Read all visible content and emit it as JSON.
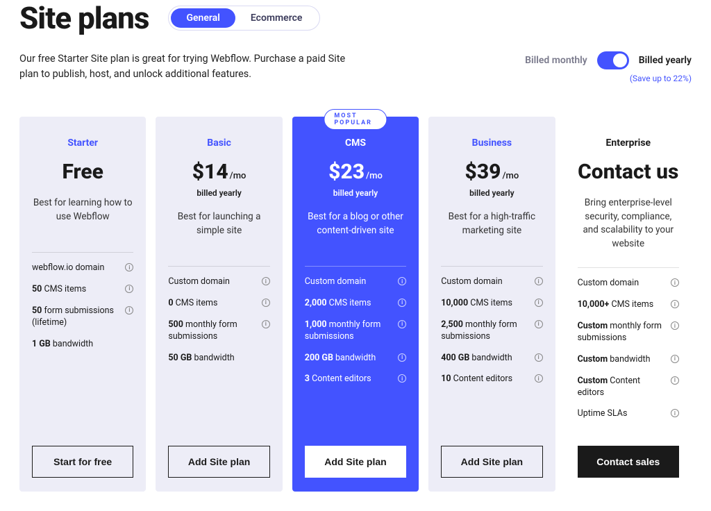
{
  "header": {
    "title": "Site plans",
    "tabs": [
      "General",
      "Ecommerce"
    ],
    "active_tab": 0
  },
  "description": "Our free Starter Site plan is great for trying Webflow. Purchase a paid Site plan to publish, host, and unlock additional features.",
  "billing": {
    "monthly_label": "Billed monthly",
    "yearly_label": "Billed yearly",
    "active": "yearly",
    "savings": "(Save up to 22%)"
  },
  "badge_text": "MOST POPULAR",
  "plans": [
    {
      "id": "starter",
      "name": "Starter",
      "price": "Free",
      "per": "",
      "billed_note": "",
      "tagline": "Best for learning how to use Webflow",
      "features": [
        {
          "bold": "",
          "text": "webflow.io domain",
          "info": true
        },
        {
          "bold": "50",
          "text": " CMS items",
          "info": true
        },
        {
          "bold": "50",
          "text": " form submissions (lifetime)",
          "info": true
        },
        {
          "bold": "1 GB",
          "text": " bandwidth",
          "info": false
        }
      ],
      "cta": "Start for free"
    },
    {
      "id": "basic",
      "name": "Basic",
      "price": "$14",
      "per": "/mo",
      "billed_note": "billed yearly",
      "tagline": "Best for launching a simple site",
      "features": [
        {
          "bold": "",
          "text": "Custom domain",
          "info": true
        },
        {
          "bold": "0",
          "text": " CMS items",
          "info": true
        },
        {
          "bold": "500",
          "text": " monthly form submissions",
          "info": true
        },
        {
          "bold": "50 GB",
          "text": " bandwidth",
          "info": false
        }
      ],
      "cta": "Add Site plan"
    },
    {
      "id": "cms",
      "name": "CMS",
      "highlight": true,
      "price": "$23",
      "per": "/mo",
      "billed_note": "billed yearly",
      "tagline": "Best for a blog or other content-driven site",
      "features": [
        {
          "bold": "",
          "text": "Custom domain",
          "info": true
        },
        {
          "bold": "2,000",
          "text": " CMS items",
          "info": true
        },
        {
          "bold": "1,000",
          "text": " monthly form submissions",
          "info": true
        },
        {
          "bold": "200 GB",
          "text": " bandwidth",
          "info": true
        },
        {
          "bold": "3",
          "text": " Content editors",
          "info": true
        }
      ],
      "cta": "Add Site plan"
    },
    {
      "id": "business",
      "name": "Business",
      "price": "$39",
      "per": "/mo",
      "billed_note": "billed yearly",
      "tagline": "Best for a high-traffic marketing site",
      "features": [
        {
          "bold": "",
          "text": "Custom domain",
          "info": true
        },
        {
          "bold": "10,000",
          "text": " CMS items",
          "info": true
        },
        {
          "bold": "2,500",
          "text": " monthly form submissions",
          "info": true
        },
        {
          "bold": "400 GB",
          "text": " bandwidth",
          "info": true
        },
        {
          "bold": "10",
          "text": " Content editors",
          "info": true
        }
      ],
      "cta": "Add Site plan"
    },
    {
      "id": "enterprise",
      "name": "Enterprise",
      "enterprise": true,
      "price": "Contact us",
      "per": "",
      "billed_note": "",
      "tagline": "Bring enterprise-level security, compliance, and scalability to your website",
      "features": [
        {
          "bold": "",
          "text": "Custom domain",
          "info": true
        },
        {
          "bold": "10,000+",
          "text": " CMS items",
          "info": true
        },
        {
          "bold": "Custom",
          "text": " monthly form submissions",
          "info": true
        },
        {
          "bold": "Custom",
          "text": " bandwidth",
          "info": true
        },
        {
          "bold": "Custom",
          "text": " Content editors",
          "info": true
        },
        {
          "bold": "",
          "text": "Uptime SLAs",
          "info": true
        }
      ],
      "cta": "Contact sales"
    }
  ]
}
